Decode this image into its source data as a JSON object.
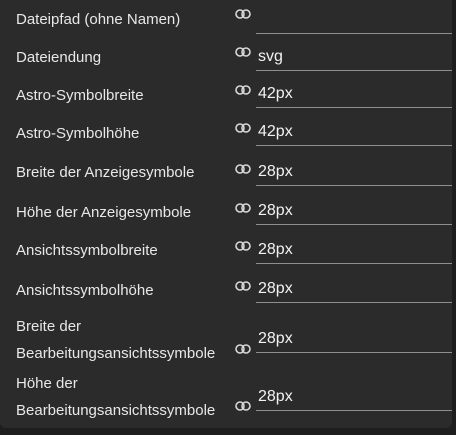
{
  "rows": [
    {
      "label": "Dateipfad (ohne Namen)",
      "value": ""
    },
    {
      "label": "Dateiendung",
      "value": "svg"
    },
    {
      "label": "Astro-Symbolbreite",
      "value": "42px"
    },
    {
      "label": "Astro-Symbolhöhe",
      "value": "42px"
    },
    {
      "label": "Breite der Anzeigesymbole",
      "value": "28px"
    },
    {
      "label": "Höhe der Anzeigesymbole",
      "value": "28px"
    },
    {
      "label": "Ansichtssymbolbreite",
      "value": "28px"
    },
    {
      "label": "Ansichtssymbolhöhe",
      "value": "28px"
    },
    {
      "label_line1": "Breite der",
      "label_line2": "Bearbeitungsansichtssymbole",
      "value": "28px"
    },
    {
      "label_line1": "Höhe der",
      "label_line2": "Bearbeitungsansichtssymbole",
      "value": "28px"
    }
  ],
  "icons": {
    "link": "link-icon"
  },
  "colors": {
    "background": "#2b2b2b",
    "text": "#e8e8e8",
    "underline": "#8f8f8f"
  }
}
